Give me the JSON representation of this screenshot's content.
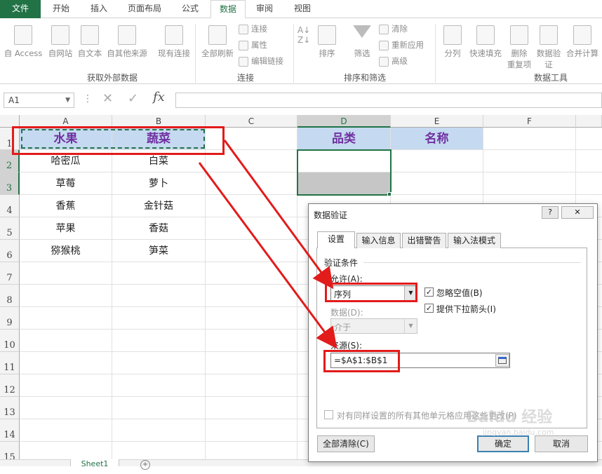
{
  "tabs": {
    "file": "文件",
    "home": "开始",
    "insert": "插入",
    "layout": "页面布局",
    "formulas": "公式",
    "data": "数据",
    "review": "审阅",
    "view": "视图"
  },
  "ribbon": {
    "ext": {
      "access": "自 Access",
      "web": "自网站",
      "text": "自文本",
      "other": "自其他来源",
      "existing": "现有连接",
      "label": "获取外部数据"
    },
    "conn": {
      "refresh": "全部刷新",
      "connections": "连接",
      "properties": "属性",
      "edit_links": "编辑链接",
      "label": "连接"
    },
    "sort": {
      "sort": "排序",
      "filter": "筛选",
      "clear": "清除",
      "reapply": "重新应用",
      "advanced": "高级",
      "label": "排序和筛选"
    },
    "tools": {
      "split": "分列",
      "flash": "快速填充",
      "remove_dup_1": "删除",
      "remove_dup_2": "重复项",
      "validation_1": "数据验",
      "validation_2": "证",
      "consolidate": "合并计算",
      "label": "数据工具"
    }
  },
  "formula_bar": {
    "name_box": "A1",
    "fx": "fx"
  },
  "columns": [
    "A",
    "B",
    "C",
    "D",
    "E",
    "F"
  ],
  "rows": [
    "1",
    "2",
    "3",
    "4",
    "5",
    "6",
    "7",
    "8",
    "9",
    "10",
    "11",
    "12",
    "13",
    "14",
    "15"
  ],
  "cells": {
    "a1": "水果",
    "b1": "蔬菜",
    "d1": "品类",
    "e1": "名称",
    "a2": "哈密瓜",
    "b2": "白菜",
    "a3": "草莓",
    "b3": "萝卜",
    "a4": "香蕉",
    "b4": "金针菇",
    "a5": "苹果",
    "b5": "香菇",
    "a6": "猕猴桃",
    "b6": "笋菜"
  },
  "sheet_tab": "Sheet1",
  "dialog": {
    "title": "数据验证",
    "help": "?",
    "close": "✕",
    "tabs": [
      "设置",
      "输入信息",
      "出错警告",
      "输入法模式"
    ],
    "criteria_label": "验证条件",
    "allow_label": "允许(A):",
    "allow_value": "序列",
    "ignore_blank": "忽略空值(B)",
    "in_cell_dropdown": "提供下拉箭头(I)",
    "data_label": "数据(D):",
    "data_value": "介于",
    "source_label": "来源(S):",
    "source_value": "=$A$1:$B$1",
    "apply_all": "对有同样设置的所有其他单元格应用这些更改(P)",
    "clear_all": "全部清除(C)",
    "ok": "确定",
    "cancel": "取消"
  },
  "watermark": "Baidu 经验",
  "watermark_url": "jingyan.baidu.com",
  "colors": {
    "accent": "#217346",
    "header_fill": "#c5d9f1",
    "header_text": "#7030a0",
    "annotation": "#e21b1b"
  }
}
